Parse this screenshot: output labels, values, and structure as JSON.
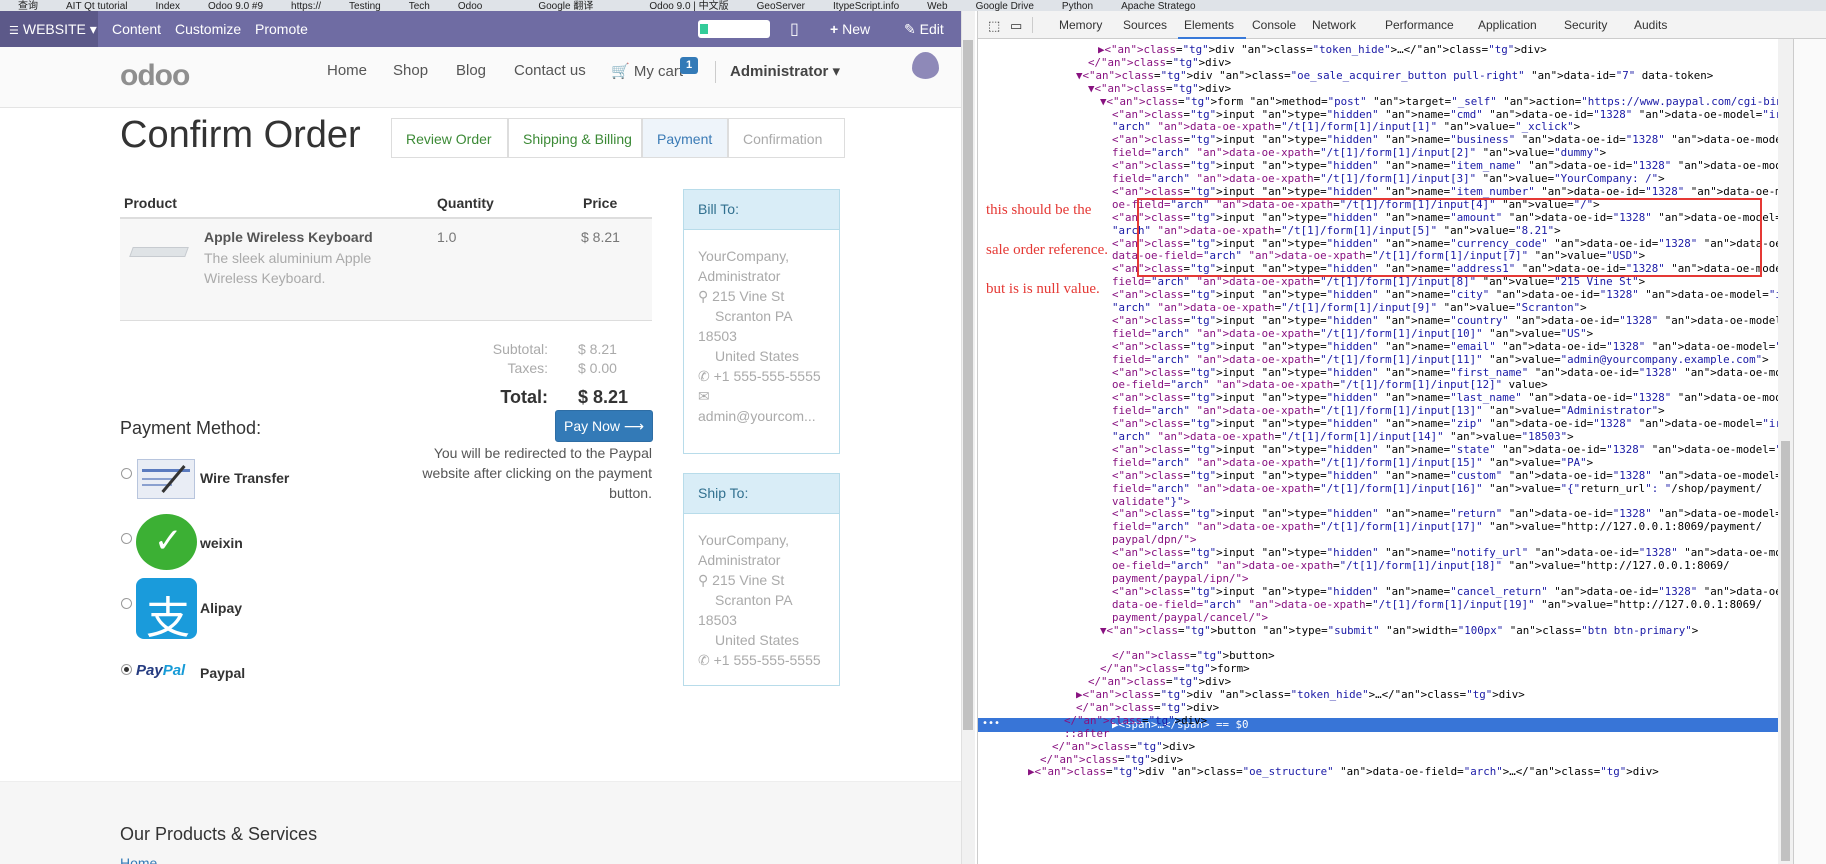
{
  "bookmarks": [
    "查询",
    "AIT Qt tutorial",
    "Index",
    "Odoo 9.0 #9",
    "https://",
    "Testing",
    "Tech",
    "Odoo",
    "",
    "Google 翻译",
    "",
    "Odoo 9.0 | 中文版",
    "GeoServer",
    "ItypeScript.info",
    "Web",
    "Google Drive",
    "Python",
    "Apache Stratego"
  ],
  "webbar": {
    "website_label": "WEBSITE",
    "content": "Content",
    "customize": "Customize",
    "promote": "Promote",
    "new_label": "New",
    "edit_label": "Edit"
  },
  "nav": {
    "logo": "odoo",
    "home": "Home",
    "shop": "Shop",
    "blog": "Blog",
    "contact": "Contact us",
    "cart": "My cart",
    "cart_count": "1",
    "user": "Administrator"
  },
  "page": {
    "title": "Confirm Order",
    "steps": [
      "Review Order",
      "Shipping & Billing",
      "Payment",
      "Confirmation"
    ]
  },
  "order": {
    "headers": {
      "product": "Product",
      "quantity": "Quantity",
      "price": "Price"
    },
    "item": {
      "name": "Apple Wireless Keyboard",
      "description": "The sleek aluminium Apple Wireless Keyboard.",
      "quantity": "1.0",
      "price": "$ 8.21"
    },
    "subtotal_label": "Subtotal:",
    "subtotal": "$ 8.21",
    "taxes_label": "Taxes:",
    "taxes": "$ 0.00",
    "total_label": "Total:",
    "total": "$ 8.21"
  },
  "payment": {
    "title": "Payment Method:",
    "methods": [
      "Wire Transfer",
      "weixin",
      "Alipay",
      "Paypal"
    ],
    "pay_button": "Pay Now",
    "redirect_note": [
      "You will be redirected to the Paypal",
      "website after clicking on the payment",
      "button."
    ]
  },
  "bill_to": {
    "title": "Bill To:",
    "lines": [
      "YourCompany,",
      "Administrator",
      "215 Vine St",
      "Scranton PA",
      "18503",
      "United States",
      "+1 555-555-5555",
      "admin@yourcom..."
    ]
  },
  "ship_to": {
    "title": "Ship To:",
    "lines": [
      "YourCompany,",
      "Administrator",
      "215 Vine St",
      "Scranton PA",
      "18503",
      "United States",
      "+1 555-555-5555"
    ]
  },
  "footer": {
    "heading": "Our Products & Services",
    "link": "Home"
  },
  "devtools": {
    "tabs": [
      "Memory",
      "Sources",
      "Elements",
      "Console",
      "Network",
      "Performance",
      "Application",
      "Security",
      "Audits"
    ],
    "active_tab": "Elements",
    "annotations": [
      "this should be the",
      "sale order reference.",
      "but is is null value."
    ],
    "selected_suffix": "== $0",
    "code": [
      [
        160,
        0,
        "▶<div class=\"token_hide\">…</div>"
      ],
      [
        150,
        0,
        "</div>"
      ],
      [
        138,
        0,
        "▼<div class=\"oe_sale_acquirer_button pull-right\" data-id=\"7\" data-token>"
      ],
      [
        150,
        0,
        "▼<div>"
      ],
      [
        162,
        0,
        "▼<form method=\"post\" target=\"_self\" action=\"https://www.paypal.com/cgi-bin/webscr\">"
      ],
      [
        174,
        0,
        "<input type=\"hidden\" name=\"cmd\" data-oe-id=\"1328\" data-oe-model=\"ir.ui.view\" data-oe-field="
      ],
      [
        174,
        0,
        "\"arch\" data-oe-xpath=\"/t[1]/form[1]/input[1]\" value=\"_xclick\">"
      ],
      [
        174,
        0,
        "<input type=\"hidden\" name=\"business\" data-oe-id=\"1328\" data-oe-model=\"ir.ui.view\" data-oe-"
      ],
      [
        174,
        0,
        "field=\"arch\" data-oe-xpath=\"/t[1]/form[1]/input[2]\" value=\"dummy\">"
      ],
      [
        174,
        0,
        "<input type=\"hidden\" name=\"item_name\" data-oe-id=\"1328\" data-oe-model=\"ir.ui.view\" data-oe-"
      ],
      [
        174,
        0,
        "field=\"arch\" data-oe-xpath=\"/t[1]/form[1]/input[3]\" value=\"YourCompany: /\">"
      ],
      [
        174,
        0,
        "<input type=\"hidden\" name=\"item_number\" data-oe-id=\"1328\" data-oe-model=\"ir.ui.view\" data-"
      ],
      [
        174,
        0,
        "oe-field=\"arch\" data-oe-xpath=\"/t[1]/form[1]/input[4]\" value=\"/\">"
      ],
      [
        174,
        0,
        "<input type=\"hidden\" name=\"amount\" data-oe-id=\"1328\" data-oe-model=\"ir.ui.view\" data-oe-field="
      ],
      [
        174,
        0,
        "\"arch\" data-oe-xpath=\"/t[1]/form[1]/input[5]\" value=\"8.21\">"
      ],
      [
        174,
        0,
        "<input type=\"hidden\" name=\"currency_code\" data-oe-id=\"1328\" data-oe-model=\"ir.ui.view\""
      ],
      [
        174,
        0,
        "data-oe-field=\"arch\" data-oe-xpath=\"/t[1]/form[1]/input[7]\" value=\"USD\">"
      ],
      [
        174,
        0,
        "<input type=\"hidden\" name=\"address1\" data-oe-id=\"1328\" data-oe-model=\"ir.ui.view\" data-oe-"
      ],
      [
        174,
        0,
        "field=\"arch\" data-oe-xpath=\"/t[1]/form[1]/input[8]\" value=\"215 Vine St\">"
      ],
      [
        174,
        0,
        "<input type=\"hidden\" name=\"city\" data-oe-id=\"1328\" data-oe-model=\"ir.ui.view\" data-oe-field="
      ],
      [
        174,
        0,
        "\"arch\" data-oe-xpath=\"/t[1]/form[1]/input[9]\" value=\"Scranton\">"
      ],
      [
        174,
        0,
        "<input type=\"hidden\" name=\"country\" data-oe-id=\"1328\" data-oe-model=\"ir.ui.view\" data-oe-"
      ],
      [
        174,
        0,
        "field=\"arch\" data-oe-xpath=\"/t[1]/form[1]/input[10]\" value=\"US\">"
      ],
      [
        174,
        0,
        "<input type=\"hidden\" name=\"email\" data-oe-id=\"1328\" data-oe-model=\"ir.ui.view\" data-oe-"
      ],
      [
        174,
        0,
        "field=\"arch\" data-oe-xpath=\"/t[1]/form[1]/input[11]\" value=\"admin@yourcompany.example.com\">"
      ],
      [
        174,
        0,
        "<input type=\"hidden\" name=\"first_name\" data-oe-id=\"1328\" data-oe-model=\"ir.ui.view\" data-"
      ],
      [
        174,
        0,
        "oe-field=\"arch\" data-oe-xpath=\"/t[1]/form[1]/input[12]\" value>"
      ],
      [
        174,
        0,
        "<input type=\"hidden\" name=\"last_name\" data-oe-id=\"1328\" data-oe-model=\"ir.ui.view\" data-oe-"
      ],
      [
        174,
        0,
        "field=\"arch\" data-oe-xpath=\"/t[1]/form[1]/input[13]\" value=\"Administrator\">"
      ],
      [
        174,
        0,
        "<input type=\"hidden\" name=\"zip\" data-oe-id=\"1328\" data-oe-model=\"ir.ui.view\" data-oe-field="
      ],
      [
        174,
        0,
        "\"arch\" data-oe-xpath=\"/t[1]/form[1]/input[14]\" value=\"18503\">"
      ],
      [
        174,
        0,
        "<input type=\"hidden\" name=\"state\" data-oe-id=\"1328\" data-oe-model=\"ir.ui.view\" data-oe-"
      ],
      [
        174,
        0,
        "field=\"arch\" data-oe-xpath=\"/t[1]/form[1]/input[15]\" value=\"PA\">"
      ],
      [
        174,
        0,
        "<input type=\"hidden\" name=\"custom\" data-oe-id=\"1328\" data-oe-model=\"ir.ui.view\" data-oe-"
      ],
      [
        174,
        0,
        "field=\"arch\" data-oe-xpath=\"/t[1]/form[1]/input[16]\" value=\"{\"return_url\": \"/shop/payment/"
      ],
      [
        174,
        0,
        "validate\"}\">"
      ],
      [
        174,
        0,
        "<input type=\"hidden\" name=\"return\" data-oe-id=\"1328\" data-oe-model=\"ir.ui.view\" data-oe-"
      ],
      [
        174,
        0,
        "field=\"arch\" data-oe-xpath=\"/t[1]/form[1]/input[17]\" value=\"http://127.0.0.1:8069/payment/"
      ],
      [
        174,
        0,
        "paypal/dpn/\">"
      ],
      [
        174,
        0,
        "<input type=\"hidden\" name=\"notify_url\" data-oe-id=\"1328\" data-oe-model=\"ir.ui.view\" data-"
      ],
      [
        174,
        0,
        "oe-field=\"arch\" data-oe-xpath=\"/t[1]/form[1]/input[18]\" value=\"http://127.0.0.1:8069/"
      ],
      [
        174,
        0,
        "payment/paypal/ipn/\">"
      ],
      [
        174,
        0,
        "<input type=\"hidden\" name=\"cancel_return\" data-oe-id=\"1328\" data-oe-model=\"ir.ui.view\""
      ],
      [
        174,
        0,
        "data-oe-field=\"arch\" data-oe-xpath=\"/t[1]/form[1]/input[19]\" value=\"http://127.0.0.1:8069/"
      ],
      [
        174,
        0,
        "payment/paypal/cancel/\">"
      ],
      [
        162,
        0,
        "▼<button type=\"submit\" width=\"100px\" class=\"btn btn-primary\">"
      ],
      [
        174,
        1,
        "▶<span>…</span> == $0"
      ],
      [
        174,
        0,
        "</button>"
      ],
      [
        162,
        0,
        "</form>"
      ],
      [
        150,
        0,
        "</div>"
      ],
      [
        138,
        0,
        "▶<div class=\"token_hide\">…</div>"
      ],
      [
        138,
        0,
        "</div>"
      ],
      [
        126,
        0,
        "</div>"
      ],
      [
        126,
        0,
        "::after"
      ],
      [
        114,
        0,
        "</div>"
      ],
      [
        102,
        0,
        "</div>"
      ],
      [
        90,
        0,
        "▶<div class=\"oe_structure\" data-oe-field=\"arch\">…</div>"
      ]
    ]
  },
  "colors": {
    "webbar": "#6f6ca3",
    "primary_button": "#337ab7",
    "annotation": "#e53935",
    "selection": "#3875d7"
  }
}
